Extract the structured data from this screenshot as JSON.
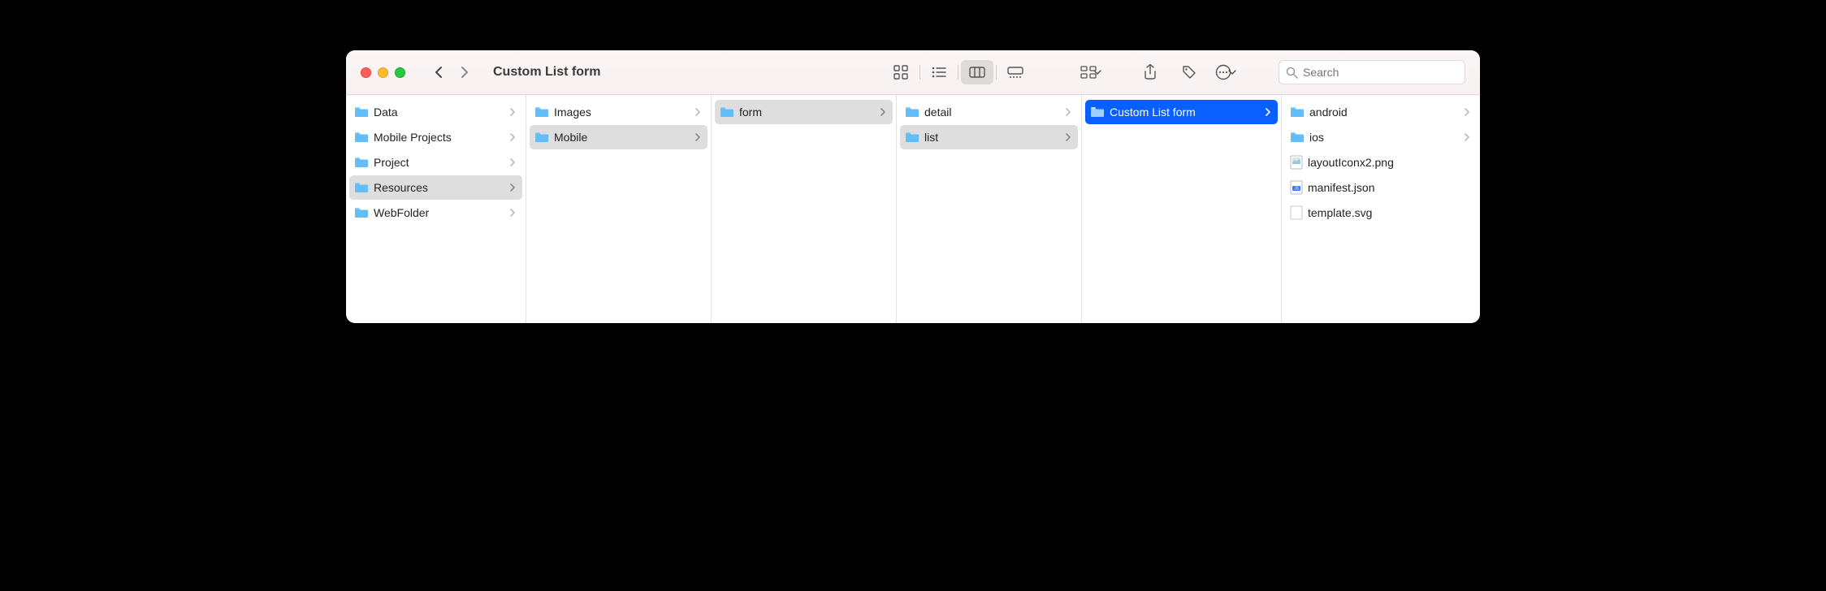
{
  "window": {
    "title": "Custom List form"
  },
  "toolbar": {
    "search_placeholder": "Search"
  },
  "columns": [
    {
      "items": [
        {
          "name": "Data",
          "type": "folder",
          "hasChildren": true,
          "state": "normal"
        },
        {
          "name": "Mobile Projects",
          "type": "folder",
          "hasChildren": true,
          "state": "normal"
        },
        {
          "name": "Project",
          "type": "folder",
          "hasChildren": true,
          "state": "normal"
        },
        {
          "name": "Resources",
          "type": "folder",
          "hasChildren": true,
          "state": "path"
        },
        {
          "name": "WebFolder",
          "type": "folder",
          "hasChildren": true,
          "state": "normal"
        }
      ]
    },
    {
      "items": [
        {
          "name": "Images",
          "type": "folder",
          "hasChildren": true,
          "state": "normal"
        },
        {
          "name": "Mobile",
          "type": "folder",
          "hasChildren": true,
          "state": "path"
        }
      ]
    },
    {
      "items": [
        {
          "name": "form",
          "type": "folder",
          "hasChildren": true,
          "state": "path"
        }
      ]
    },
    {
      "items": [
        {
          "name": "detail",
          "type": "folder",
          "hasChildren": true,
          "state": "normal"
        },
        {
          "name": "list",
          "type": "folder",
          "hasChildren": true,
          "state": "path"
        }
      ]
    },
    {
      "items": [
        {
          "name": "Custom List form",
          "type": "folder",
          "hasChildren": true,
          "state": "selected"
        }
      ]
    },
    {
      "items": [
        {
          "name": "android",
          "type": "folder",
          "hasChildren": true,
          "state": "normal"
        },
        {
          "name": "ios",
          "type": "folder",
          "hasChildren": true,
          "state": "normal"
        },
        {
          "name": "layoutIconx2.png",
          "type": "file-image",
          "hasChildren": false,
          "state": "normal"
        },
        {
          "name": "manifest.json",
          "type": "file-json",
          "hasChildren": false,
          "state": "normal"
        },
        {
          "name": "template.svg",
          "type": "file-blank",
          "hasChildren": false,
          "state": "normal"
        }
      ]
    }
  ]
}
